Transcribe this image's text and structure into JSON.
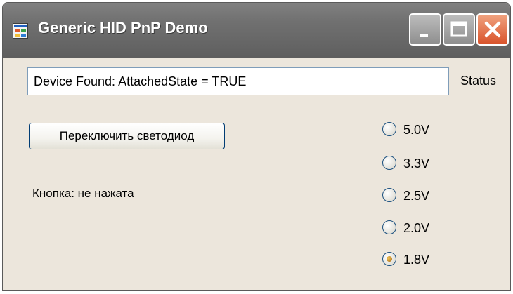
{
  "window": {
    "title": "Generic HID PnP Demo",
    "icon": "app-window-icon",
    "controls": [
      "minimize-icon",
      "maximize-icon",
      "close-icon"
    ]
  },
  "status": {
    "value": "Device Found: AttachedState = TRUE",
    "label": "Status"
  },
  "led_button": {
    "label": "Переключить светодиод"
  },
  "button_state": {
    "text": "Кнопка: не нажата"
  },
  "voltage": {
    "options": [
      {
        "label": "5.0V",
        "checked": false
      },
      {
        "label": "3.3V",
        "checked": false
      },
      {
        "label": "2.5V",
        "checked": false
      },
      {
        "label": "2.0V",
        "checked": false
      },
      {
        "label": "1.8V",
        "checked": true
      }
    ]
  },
  "colors": {
    "form_background": "#ece6dc",
    "titlebar": "#707070",
    "close_button": "#d9532b",
    "radio_selected": "#c88a1e"
  }
}
